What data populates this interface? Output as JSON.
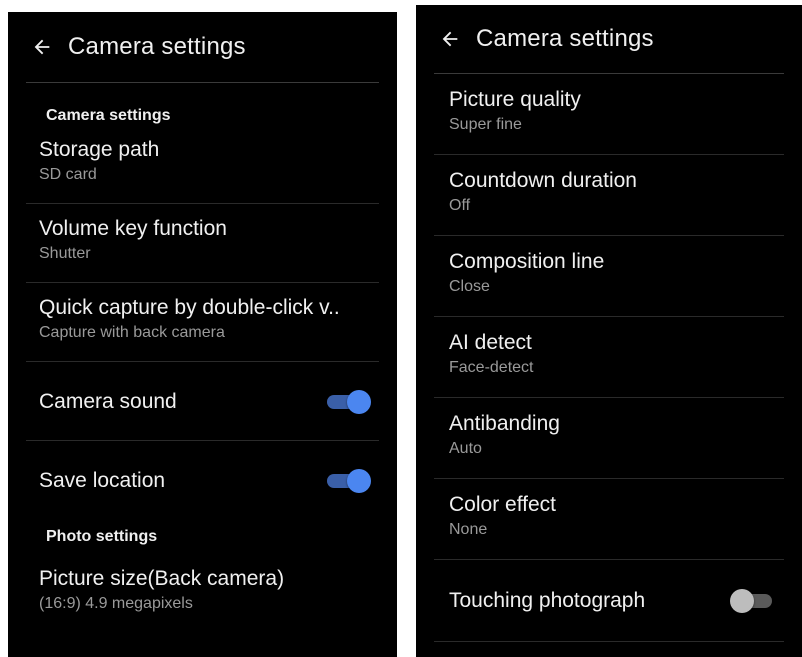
{
  "left_panel": {
    "appbar": {
      "title": "Camera settings",
      "back_icon": "arrow-left-icon"
    },
    "sections": [
      {
        "header": "Camera settings",
        "items": [
          {
            "title": "Storage path",
            "summary": "SD card"
          },
          {
            "title": "Volume key function",
            "summary": "Shutter"
          },
          {
            "title": "Quick capture by double-click v..",
            "summary": "Capture with back camera"
          },
          {
            "title": "Camera sound",
            "toggle": true
          },
          {
            "title": "Save location",
            "toggle": true
          }
        ]
      },
      {
        "header": "Photo settings",
        "items": [
          {
            "title": "Picture size(Back camera)",
            "summary": "(16:9) 4.9 megapixels"
          }
        ]
      }
    ]
  },
  "right_panel": {
    "appbar": {
      "title": "Camera settings",
      "back_icon": "arrow-left-icon"
    },
    "items": [
      {
        "title": "Picture quality",
        "summary": "Super fine"
      },
      {
        "title": "Countdown duration",
        "summary": "Off"
      },
      {
        "title": "Composition line",
        "summary": "Close"
      },
      {
        "title": "AI detect",
        "summary": "Face-detect"
      },
      {
        "title": "Antibanding",
        "summary": "Auto"
      },
      {
        "title": "Color effect",
        "summary": "None"
      },
      {
        "title": "Touching photograph",
        "toggle": false
      }
    ]
  },
  "colors": {
    "background": "#000000",
    "switch_on": "#4b86f0",
    "switch_off": "#bdbdbd"
  }
}
